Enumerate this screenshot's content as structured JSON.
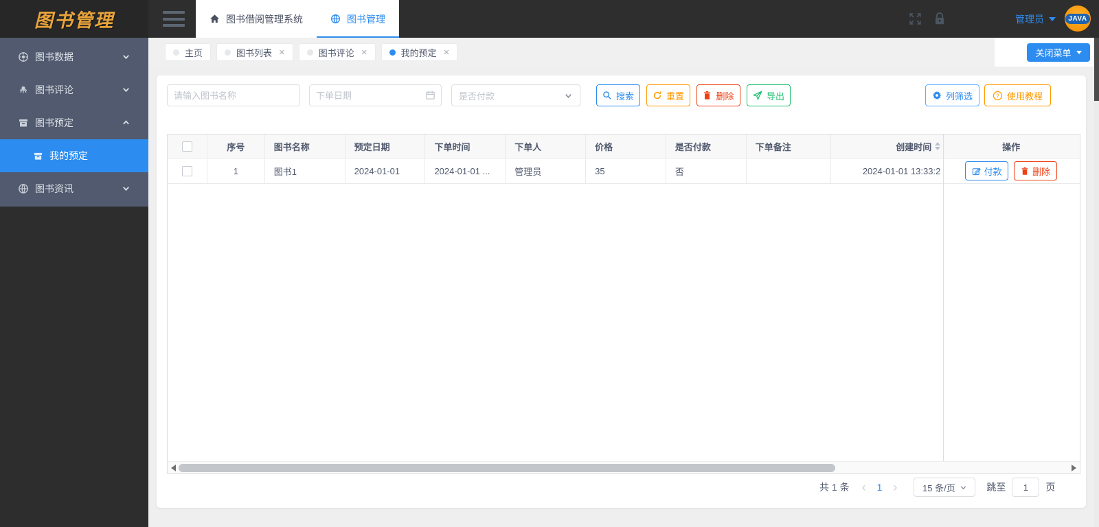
{
  "app": {
    "logo": "图书管理",
    "user": "管理员",
    "avatar_badge": "JAVA"
  },
  "header": {
    "nav": [
      {
        "label": "图书借阅管理系统"
      },
      {
        "label": "图书管理"
      }
    ]
  },
  "chips": {
    "items": [
      {
        "label": "主页"
      },
      {
        "label": "图书列表"
      },
      {
        "label": "图书评论"
      },
      {
        "label": "我的预定"
      }
    ],
    "close_glyph": "×",
    "close_menu": "关闭菜单"
  },
  "sidebar": {
    "items": [
      {
        "label": "图书数据"
      },
      {
        "label": "图书评论"
      },
      {
        "label": "图书预定"
      },
      {
        "label": "我的预定"
      },
      {
        "label": "图书资讯"
      }
    ]
  },
  "search": {
    "name_placeholder": "请输入图书名称",
    "date_placeholder": "下单日期",
    "paid_placeholder": "是否付款",
    "buttons": {
      "search": "搜索",
      "reset": "重置",
      "delete": "删除",
      "export": "导出"
    },
    "right": {
      "filter": "列筛选",
      "tutorial": "使用教程"
    }
  },
  "table": {
    "columns": [
      "序号",
      "图书名称",
      "预定日期",
      "下单时间",
      "下单人",
      "价格",
      "是否付款",
      "下单备注",
      "创建时间",
      "操作"
    ],
    "row": {
      "index": "1",
      "book": "图书1",
      "reserve_date": "2024-01-01",
      "order_time": "2024-01-01 ...",
      "orderer": "管理员",
      "price": "35",
      "paid": "否",
      "remark": "",
      "created": "2024-01-01 13:33:2"
    },
    "actions": {
      "pay": "付款",
      "delete": "删除"
    }
  },
  "pagination": {
    "total": "共 1 条",
    "prev_glyph": "‹",
    "page": "1",
    "next_glyph": "›",
    "page_size": "15 条/页",
    "jump_label": "跳至",
    "jump_value": "1",
    "page_label": "页"
  },
  "colors": {
    "accent": "#2d8cf0",
    "warning": "#ff9900",
    "danger": "#ed4014",
    "success": "#19be6b",
    "sidebar": "#515a6e",
    "header_dark": "#2e2e2e",
    "logo_orange": "#e8a33b"
  }
}
